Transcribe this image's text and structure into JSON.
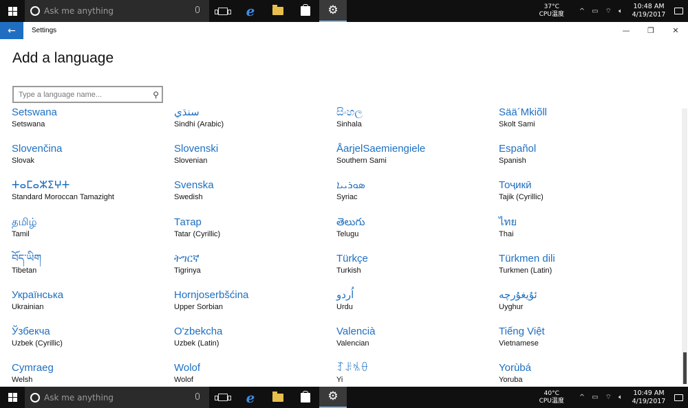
{
  "taskbar_top": {
    "search_placeholder": "Ask me anything",
    "temp": "37°C",
    "cpu_label": "CPU温度",
    "time": "10:48 AM",
    "date": "4/19/2017"
  },
  "taskbar_bottom": {
    "search_placeholder": "Ask me anything",
    "temp": "40°C",
    "cpu_label": "CPU温度",
    "time": "10:49 AM",
    "date": "4/19/2017"
  },
  "titlebar": {
    "title": "Settings",
    "back_icon": "←",
    "minimize": "—",
    "maximize": "❐",
    "close": "✕"
  },
  "page": {
    "title": "Add a language",
    "search_placeholder": "Type a language name..."
  },
  "languages": [
    {
      "native": "Setswana",
      "english": "Setswana"
    },
    {
      "native": "سنڌي",
      "english": "Sindhi (Arabic)"
    },
    {
      "native": "සිංහල",
      "english": "Sinhala"
    },
    {
      "native": "Sää´Mkiõll",
      "english": "Skolt Sami"
    },
    {
      "native": "Slovenčina",
      "english": "Slovak"
    },
    {
      "native": "Slovenski",
      "english": "Slovenian"
    },
    {
      "native": "ÅarjelSaemiengiele",
      "english": "Southern Sami"
    },
    {
      "native": "Español",
      "english": "Spanish"
    },
    {
      "native": "ⵜⴰⵎⴰⵣⵉⵖⵜ",
      "english": "Standard Moroccan Tamazight"
    },
    {
      "native": "Svenska",
      "english": "Swedish"
    },
    {
      "native": "ܣܘܪܝܝܐ",
      "english": "Syriac"
    },
    {
      "native": "Тоҷикӣ",
      "english": "Tajik (Cyrillic)"
    },
    {
      "native": "தமிழ்",
      "english": "Tamil"
    },
    {
      "native": "Татар",
      "english": "Tatar (Cyrillic)"
    },
    {
      "native": "తెలుగు",
      "english": "Telugu"
    },
    {
      "native": "ไทย",
      "english": "Thai"
    },
    {
      "native": "བོད་ཡིག",
      "english": "Tibetan"
    },
    {
      "native": "ትግርኛ",
      "english": "Tigrinya"
    },
    {
      "native": "Türkçe",
      "english": "Turkish"
    },
    {
      "native": "Türkmen dili",
      "english": "Turkmen (Latin)"
    },
    {
      "native": "Українська",
      "english": "Ukrainian"
    },
    {
      "native": "Hornjoserbšćina",
      "english": "Upper Sorbian"
    },
    {
      "native": "اُردو",
      "english": "Urdu"
    },
    {
      "native": "ئۇيغۇرچە",
      "english": "Uyghur"
    },
    {
      "native": "Ўзбекча",
      "english": "Uzbek (Cyrillic)"
    },
    {
      "native": "O'zbekcha",
      "english": "Uzbek (Latin)"
    },
    {
      "native": "Valencià",
      "english": "Valencian"
    },
    {
      "native": "Tiếng Việt",
      "english": "Vietnamese"
    },
    {
      "native": "Cymraeg",
      "english": "Welsh"
    },
    {
      "native": "Wolof",
      "english": "Wolof"
    },
    {
      "native": "ꆈꌠꁱꂷ",
      "english": "Yi"
    },
    {
      "native": "Yorùbá",
      "english": "Yoruba"
    }
  ],
  "colors": {
    "accent": "#1d6fc2",
    "taskbar": "#101010"
  }
}
